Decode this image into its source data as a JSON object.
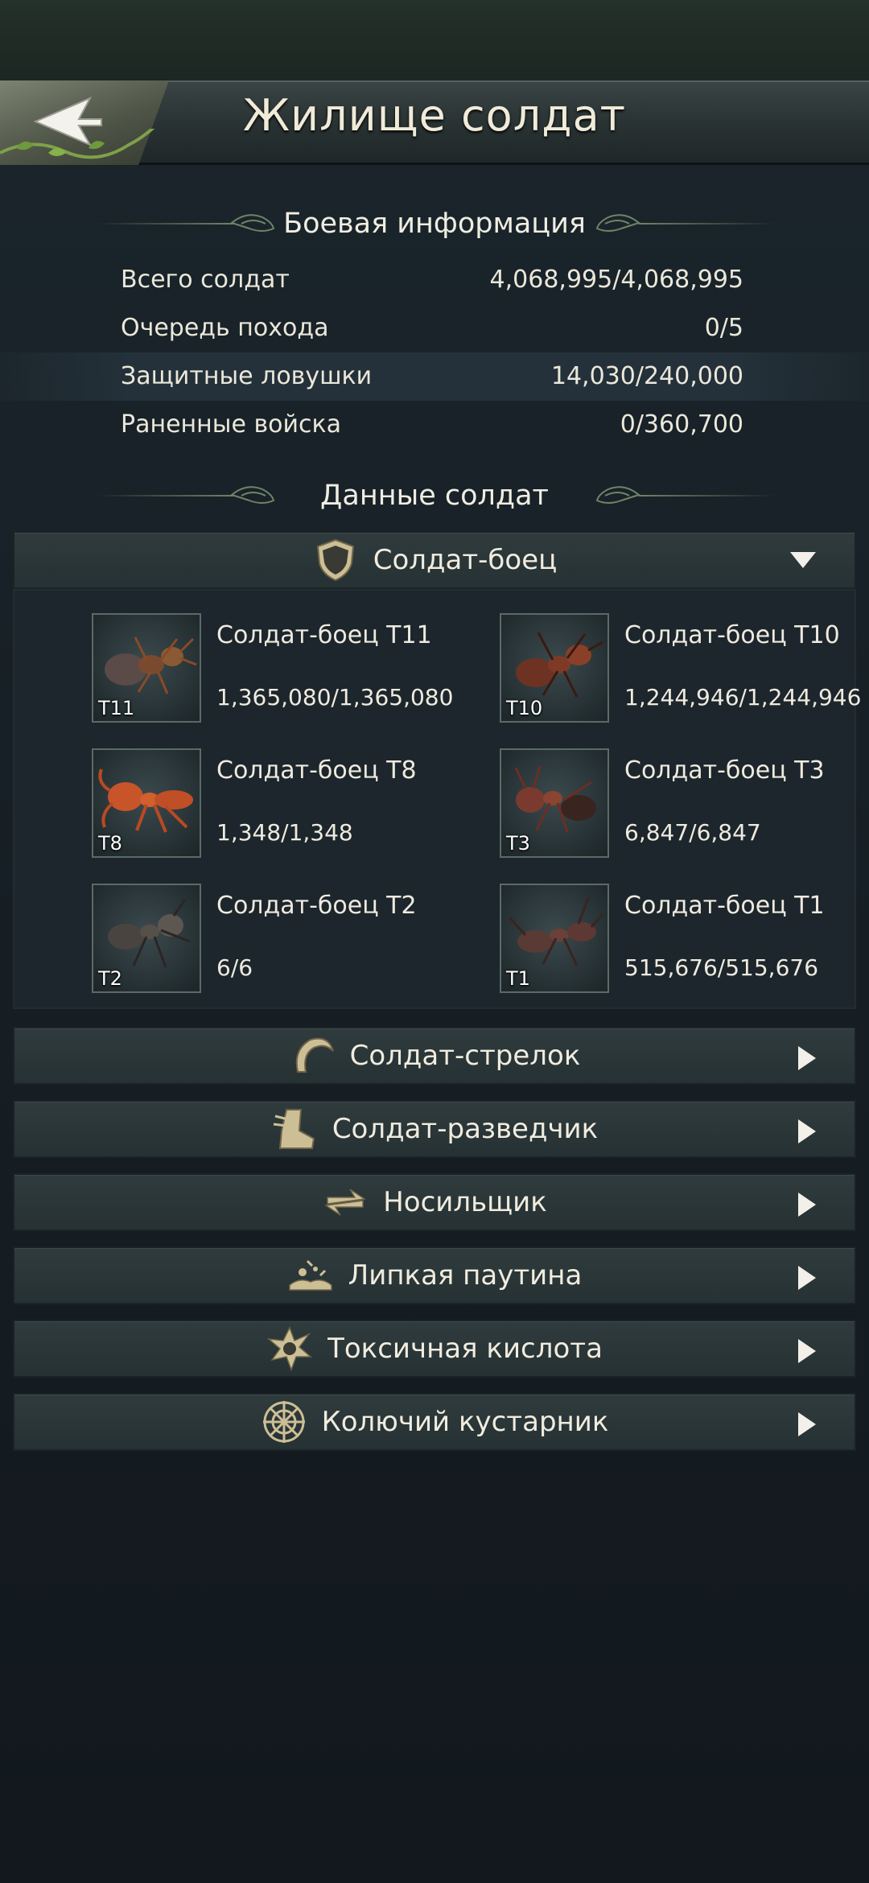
{
  "header": {
    "title": "Жилище солдат",
    "back_icon": "back-arrow-icon"
  },
  "battle_info": {
    "heading": "Боевая информация",
    "rows": [
      {
        "label": "Всего солдат",
        "value": "4,068,995/4,068,995"
      },
      {
        "label": "Очередь похода",
        "value": "0/5"
      },
      {
        "label": "Защитные ловушки",
        "value": "14,030/240,000"
      },
      {
        "label": "Раненные войска",
        "value": "0/360,700"
      }
    ]
  },
  "soldier_data": {
    "heading": "Данные солдат",
    "expanded": {
      "label": "Солдат-боец",
      "icon": "shield-icon",
      "units": [
        {
          "tier": "T11",
          "name": "Солдат-боец T11",
          "count": "1,365,080/1,365,080",
          "color": "#6b4a3a"
        },
        {
          "tier": "T10",
          "name": "Солдат-боец T10",
          "count": "1,244,946/1,244,946",
          "color": "#7a3b2a"
        },
        {
          "tier": "T8",
          "name": "Солдат-боец T8",
          "count": "1,348/1,348",
          "color": "#c0552a"
        },
        {
          "tier": "T3",
          "name": "Солдат-боец T3",
          "count": "6,847/6,847",
          "color": "#8a4a3a"
        },
        {
          "tier": "T2",
          "name": "Солдат-боец T2",
          "count": "6/6",
          "color": "#4a4440"
        },
        {
          "tier": "T1",
          "name": "Солдат-боец T1",
          "count": "515,676/515,676",
          "color": "#5a3a34"
        }
      ]
    },
    "collapsed": [
      {
        "label": "Солдат-стрелок",
        "icon": "shooter-claw-icon"
      },
      {
        "label": "Солдат-разведчик",
        "icon": "scout-boot-icon"
      },
      {
        "label": "Носильщик",
        "icon": "carrier-arrows-icon"
      },
      {
        "label": "Липкая паутина",
        "icon": "sticky-web-icon"
      },
      {
        "label": "Токсичная кислота",
        "icon": "toxic-acid-icon"
      },
      {
        "label": "Колючий кустарник",
        "icon": "thorny-bush-icon"
      }
    ]
  },
  "colors": {
    "accent_gold": "#c9b88a",
    "text": "#efeadf",
    "arrow": "#f2f0e8"
  }
}
